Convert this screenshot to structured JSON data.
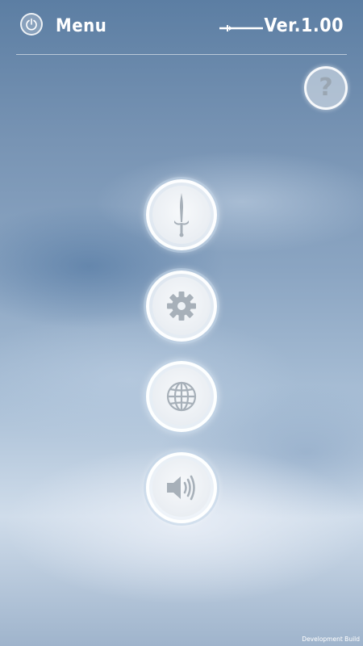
{
  "header": {
    "title": "Menu",
    "version": "Ver.1.00",
    "power_icon": "power-icon",
    "decoration_icon": "sword-icon"
  },
  "help": {
    "label": "?"
  },
  "menu_buttons": [
    {
      "icon": "dagger-icon"
    },
    {
      "icon": "gear-icon"
    },
    {
      "icon": "globe-icon"
    },
    {
      "icon": "speaker-icon"
    }
  ],
  "footer": {
    "build_label": "Development Build"
  },
  "colors": {
    "icon_gray": "#a7b0b9",
    "text": "#ffffff"
  }
}
